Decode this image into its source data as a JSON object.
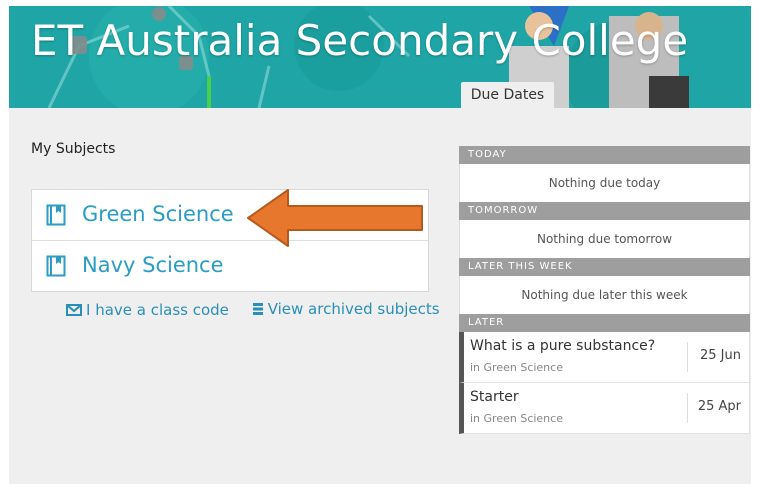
{
  "banner": {
    "title": "ET Australia Secondary College",
    "tab_label": "Due Dates"
  },
  "left": {
    "heading": "My Subjects",
    "subjects": [
      {
        "name": "Green Science"
      },
      {
        "name": "Navy Science"
      }
    ],
    "links": {
      "class_code": "I have a class code",
      "archived": "View archived subjects"
    }
  },
  "due": {
    "today": {
      "header": "TODAY",
      "empty": "Nothing due today"
    },
    "tomorrow": {
      "header": "TOMORROW",
      "empty": "Nothing due tomorrow"
    },
    "later_this_week": {
      "header": "LATER THIS WEEK",
      "empty": "Nothing due later this week"
    },
    "later": {
      "header": "LATER",
      "items": [
        {
          "title": "What is a pure substance?",
          "subject": "in Green Science",
          "date": "25 Jun"
        },
        {
          "title": "Starter",
          "subject": "in Green Science",
          "date": "25 Apr"
        }
      ]
    }
  },
  "colors": {
    "banner": "#1fa5a5",
    "link": "#2a9dc4",
    "arrow": "#e8772e",
    "section_header": "#9e9e9e"
  },
  "icons": [
    "book-icon",
    "envelope-icon",
    "archive-icon",
    "arrow-pointer"
  ]
}
